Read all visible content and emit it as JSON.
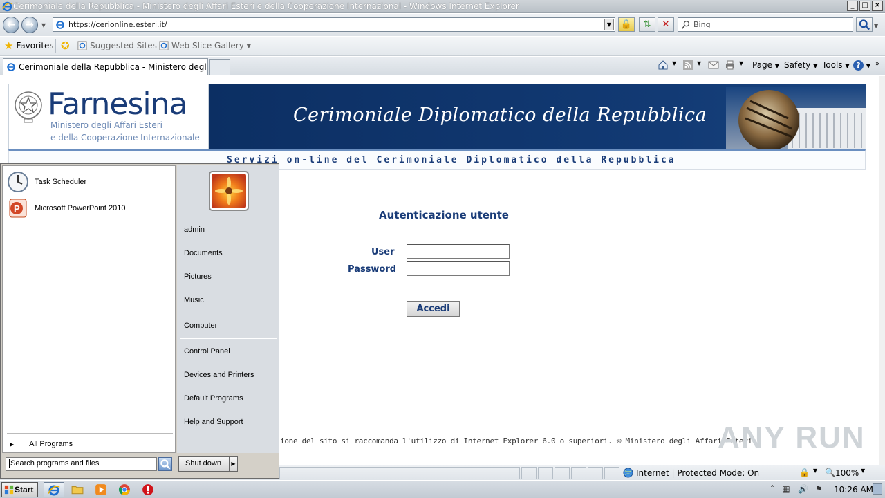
{
  "window": {
    "title": "Cerimoniale della Repubblica - Ministero degli Affari Esteri e della Cooperazione Internazional - Windows Internet Explorer",
    "controls": [
      "_",
      "□",
      "×"
    ]
  },
  "address": {
    "url": "https://cerionline.esteri.it/"
  },
  "search": {
    "placeholder": "Bing"
  },
  "favorites_bar": {
    "favorites_label": "Favorites",
    "suggested_sites_label": "Suggested Sites",
    "web_slice_label": "Web Slice Gallery"
  },
  "tabs": [
    {
      "label": "Cerimoniale della Repubblica - Ministero degli Affari Es..."
    }
  ],
  "command_bar": {
    "page": "Page",
    "safety": "Safety",
    "tools": "Tools",
    "help": "?"
  },
  "site": {
    "brand": "Farnesina",
    "ministry_line1": "Ministero degli Affari Esteri",
    "ministry_line2": "e della Cooperazione Internazionale",
    "banner_title": "Cerimoniale Diplomatico della Repubblica",
    "services_strip": "Servizi on-line del Cerimoniale Diplomatico della Repubblica",
    "auth_title": "Autenticazione utente",
    "user_label": "User",
    "password_label": "Password",
    "user_value": "",
    "password_value": "",
    "submit_label": "Accedi",
    "footer": "ione del sito si raccomanda l'utilizzo di Internet Explorer 6.0 o superiori. © Ministero degli Affari Esteri"
  },
  "watermark": "ANY RUN",
  "statusbar": {
    "zone": "Internet | Protected Mode: On",
    "zoom": "100%"
  },
  "start_menu": {
    "pinned_programs": [
      {
        "label": "Task Scheduler",
        "icon": "clock-icon"
      },
      {
        "label": "Microsoft PowerPoint 2010",
        "icon": "powerpoint-icon"
      }
    ],
    "all_programs": "All Programs",
    "search_placeholder": "Search programs and files",
    "right_links_group1": [
      "admin",
      "Documents",
      "Pictures",
      "Music"
    ],
    "right_links_group2": [
      "Computer"
    ],
    "right_links_group3": [
      "Control Panel",
      "Devices and Printers",
      "Default Programs",
      "Help and Support"
    ],
    "shutdown_label": "Shut down"
  },
  "taskbar": {
    "start_label": "Start",
    "clock": "10:26 AM"
  },
  "colors": {
    "brand_navy": "#1a3c78",
    "banner_bg": "#0c2f63",
    "ministry_text": "#6a87b3"
  }
}
